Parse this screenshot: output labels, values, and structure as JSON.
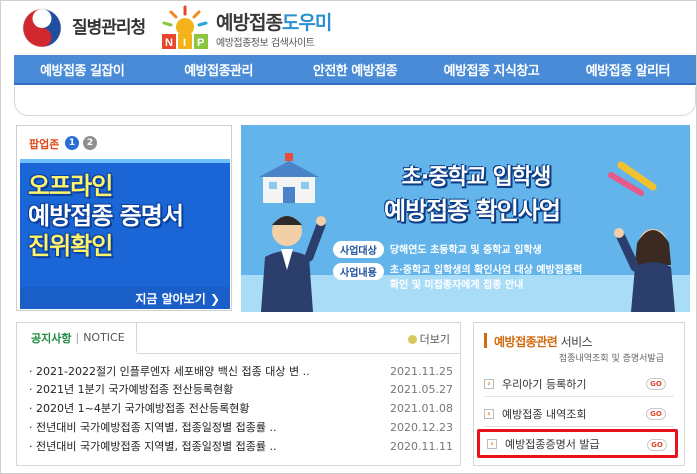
{
  "header": {
    "agency_name": "질병관리청",
    "site_title_main": "예방접종",
    "site_title_accent": "도우미",
    "site_subtitle": "예방접종정보 검색사이트",
    "nip_letters": "NIP"
  },
  "nav": {
    "items": [
      "예방접종 길잡이",
      "예방접종관리",
      "안전한 예방접종",
      "예방접종 지식창고",
      "예방접종 알리터"
    ]
  },
  "popup": {
    "label": "팝업존",
    "pages": [
      "1",
      "2"
    ],
    "banner_lines": [
      "오프라인",
      "예방접종 증명서",
      "진위확인"
    ],
    "more_text": "지금 알아보기 ❯"
  },
  "main_banner": {
    "title_line1": "초·중학교 입학생",
    "title_line2": "예방접종 확인사업",
    "row1_tag": "사업대상",
    "row1_text": "당해연도 초등학교 및 중학교 입학생",
    "row2_tag": "사업내용",
    "row2_text": "초·중학교 입학생의 확인사업 대상 예방접종력 확인 및 미접종자에게 접종 안내"
  },
  "notice": {
    "tab_ko": "공지사항",
    "tab_sep": "|",
    "tab_en": "NOTICE",
    "more": "더보기",
    "items": [
      {
        "title": "· 2021-2022절기 인플루엔자 세포배양 백신 접종 대상 변 ..",
        "date": "2021.11.25"
      },
      {
        "title": "· 2021년 1분기 국가예방접종 전산등록현황",
        "date": "2021.05.27"
      },
      {
        "title": "· 2020년 1~4분기 국가예방접종 전산등록현황",
        "date": "2021.01.08"
      },
      {
        "title": "· 전년대비 국가예방접종 지역별, 접종일정별 접종률 ..",
        "date": "2020.12.23"
      },
      {
        "title": "· 전년대비 국가예방접종 지역별, 접종일정별 접종률 ..",
        "date": "2020.11.11"
      }
    ]
  },
  "services": {
    "title_accent": "예방접종관련",
    "title_rest": " 서비스",
    "subtitle": "접종내역조회 및 증명서발급",
    "items": [
      {
        "label": "우리아기 등록하기",
        "go": "GO"
      },
      {
        "label": "예방접종 내역조회",
        "go": "GO"
      },
      {
        "label": "예방접종증명서 발급",
        "go": "GO"
      }
    ],
    "arrow_glyph": "›"
  },
  "colors": {
    "nav": "#4a8bd8",
    "popup_banner": "#1a66d6",
    "main_banner": "#62b4ea",
    "notice_accent": "#1d8a3c",
    "service_accent": "#d36a0e",
    "highlight": "#e8121c"
  }
}
